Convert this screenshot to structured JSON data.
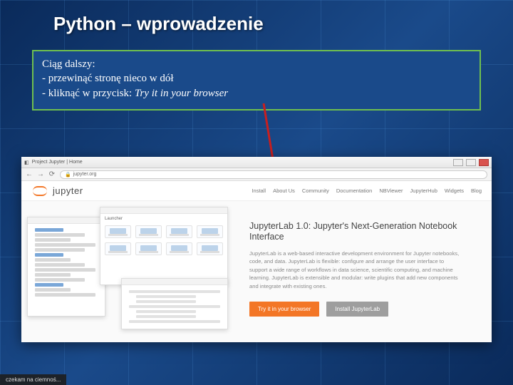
{
  "slide": {
    "title": "Python – wprowadzenie",
    "instruction": {
      "heading": "Ciąg dalszy:",
      "line1": "- przewinąć stronę nieco w dół",
      "line2_prefix": "- kliknąć w przycisk: ",
      "line2_em": "Try it in your browser"
    },
    "taskbar_hint": "czekam na ciemnoś..."
  },
  "browser": {
    "window_title": "Project Jupyter | Home",
    "nav_icons": {
      "back": "←",
      "forward": "→",
      "reload": "⟳"
    },
    "url": "jupyter.org",
    "logo_text": "jupyter",
    "nav_items": [
      "Install",
      "About Us",
      "Community",
      "Documentation",
      "NBViewer",
      "JupyterHub",
      "Widgets",
      "Blog"
    ],
    "thumb2_title": "Launcher"
  },
  "content": {
    "headline": "JupyterLab 1.0: Jupyter's Next-Generation Notebook Interface",
    "paragraph": "JupyterLab is a web-based interactive development environment for Jupyter notebooks, code, and data. JupyterLab is flexible: configure and arrange the user interface to support a wide range of workflows in data science, scientific computing, and machine learning. JupyterLab is extensible and modular: write plugins that add new components and integrate with existing ones.",
    "btn_try": "Try it in your browser",
    "btn_install": "Install JupyterLab"
  }
}
